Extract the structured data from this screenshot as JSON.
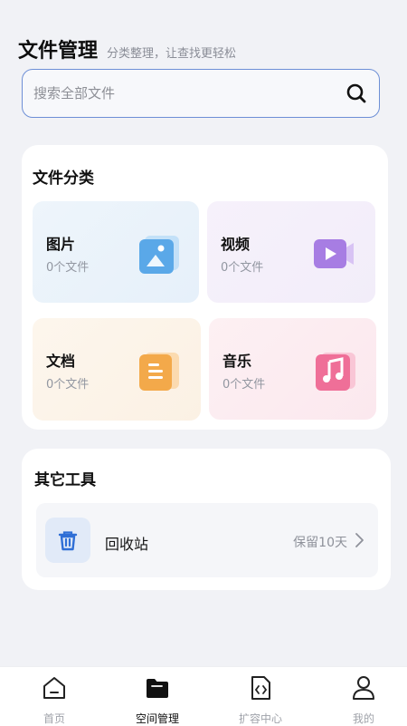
{
  "header": {
    "title": "文件管理",
    "subtitle": "分类整理，让查找更轻松"
  },
  "search": {
    "placeholder": "搜索全部文件"
  },
  "categories": {
    "title": "文件分类",
    "items": [
      {
        "name": "图片",
        "count": "0个文件",
        "icon": "image-icon",
        "color": "#5aa8e8"
      },
      {
        "name": "视频",
        "count": "0个文件",
        "icon": "video-icon",
        "color": "#a77de3"
      },
      {
        "name": "文档",
        "count": "0个文件",
        "icon": "document-icon",
        "color": "#f3a94a"
      },
      {
        "name": "音乐",
        "count": "0个文件",
        "icon": "music-icon",
        "color": "#ef6f98"
      }
    ]
  },
  "tools": {
    "title": "其它工具",
    "recycle": {
      "label": "回收站",
      "retention": "保留10天",
      "icon": "trash-icon",
      "color": "#2f6fd6"
    }
  },
  "nav": {
    "items": [
      {
        "label": "首页",
        "icon": "home-icon",
        "active": false
      },
      {
        "label": "空间管理",
        "icon": "folder-icon",
        "active": true
      },
      {
        "label": "扩容中心",
        "icon": "code-file-icon",
        "active": false
      },
      {
        "label": "我的",
        "icon": "user-icon",
        "active": false
      }
    ]
  }
}
